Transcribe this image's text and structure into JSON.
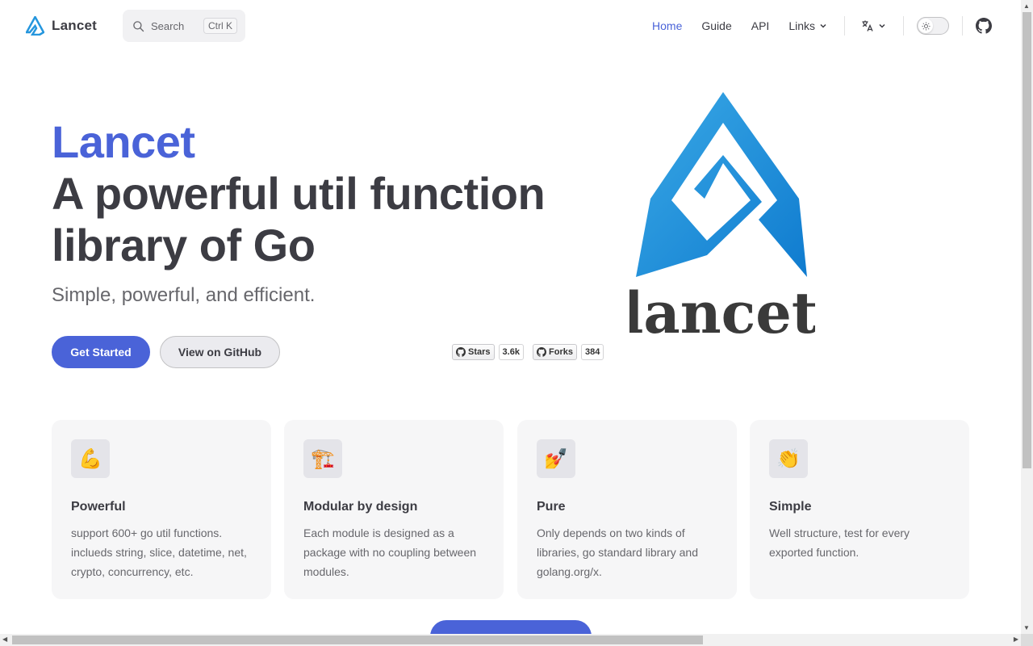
{
  "nav": {
    "title": "Lancet",
    "logo_icon": "lancet-logo-icon",
    "search": {
      "label": "Search",
      "shortcut": "Ctrl K"
    },
    "links": [
      {
        "label": "Home",
        "active": true
      },
      {
        "label": "Guide",
        "active": false
      },
      {
        "label": "API",
        "active": false
      },
      {
        "label": "Links",
        "active": false,
        "dropdown": true
      }
    ],
    "language_icon": "translate-icon",
    "theme_icon": "sun-icon",
    "social_icon": "github-icon"
  },
  "hero": {
    "name": "Lancet",
    "text": "A powerful util function library of Go",
    "tagline": "Simple, powerful, and efficient.",
    "actions": {
      "primary": "Get Started",
      "secondary": "View on GitHub"
    },
    "badges": {
      "stars_label": "Stars",
      "stars_count": "3.6k",
      "forks_label": "Forks",
      "forks_count": "384"
    },
    "image_word": "lancet"
  },
  "features": [
    {
      "icon": "💪",
      "title": "Powerful",
      "details": "support 600+ go util functions. inclueds string, slice, datetime, net, crypto, concurrency, etc."
    },
    {
      "icon": "🏗️",
      "title": "Modular by design",
      "details": "Each module is designed as a package with no coupling between modules."
    },
    {
      "icon": "💅",
      "title": "Pure",
      "details": "Only depends on two kinds of libraries, go standard library and golang.org/x."
    },
    {
      "icon": "👏",
      "title": "Simple",
      "details": "Well structure, test for every exported function."
    }
  ],
  "colors": {
    "brand": "#4a63d8",
    "logo_blue": "#1a8ad8",
    "text": "#3c3c43",
    "muted": "#67676c"
  }
}
